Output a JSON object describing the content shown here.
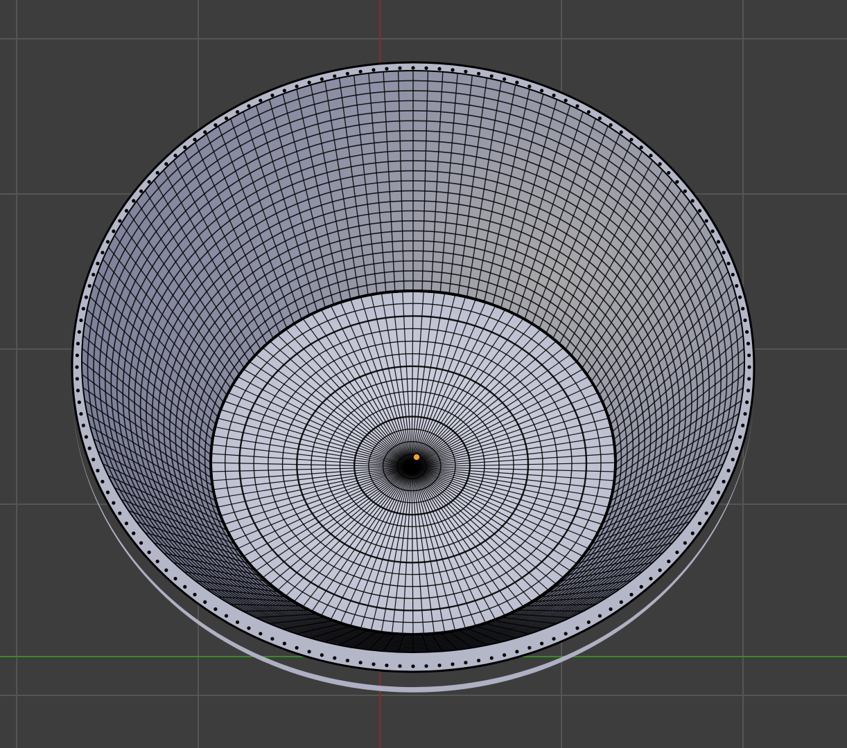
{
  "viewport": {
    "background_color": "#3d3d3d",
    "grid_line_color": "#555555",
    "x_axis_color": "#3a8a2a",
    "y_axis_color": "#8a2c2c"
  },
  "mesh": {
    "name": "bowl",
    "view": "top",
    "display_mode": "edit-mode-wireframe",
    "vertices_shown": true,
    "surface_light_color": "#c8ccdc",
    "surface_shade_color": "#8f92a6",
    "edge_color": "#000000"
  },
  "origin_marker": {
    "icon": "object-origin-dot",
    "color": "#f0a030"
  }
}
